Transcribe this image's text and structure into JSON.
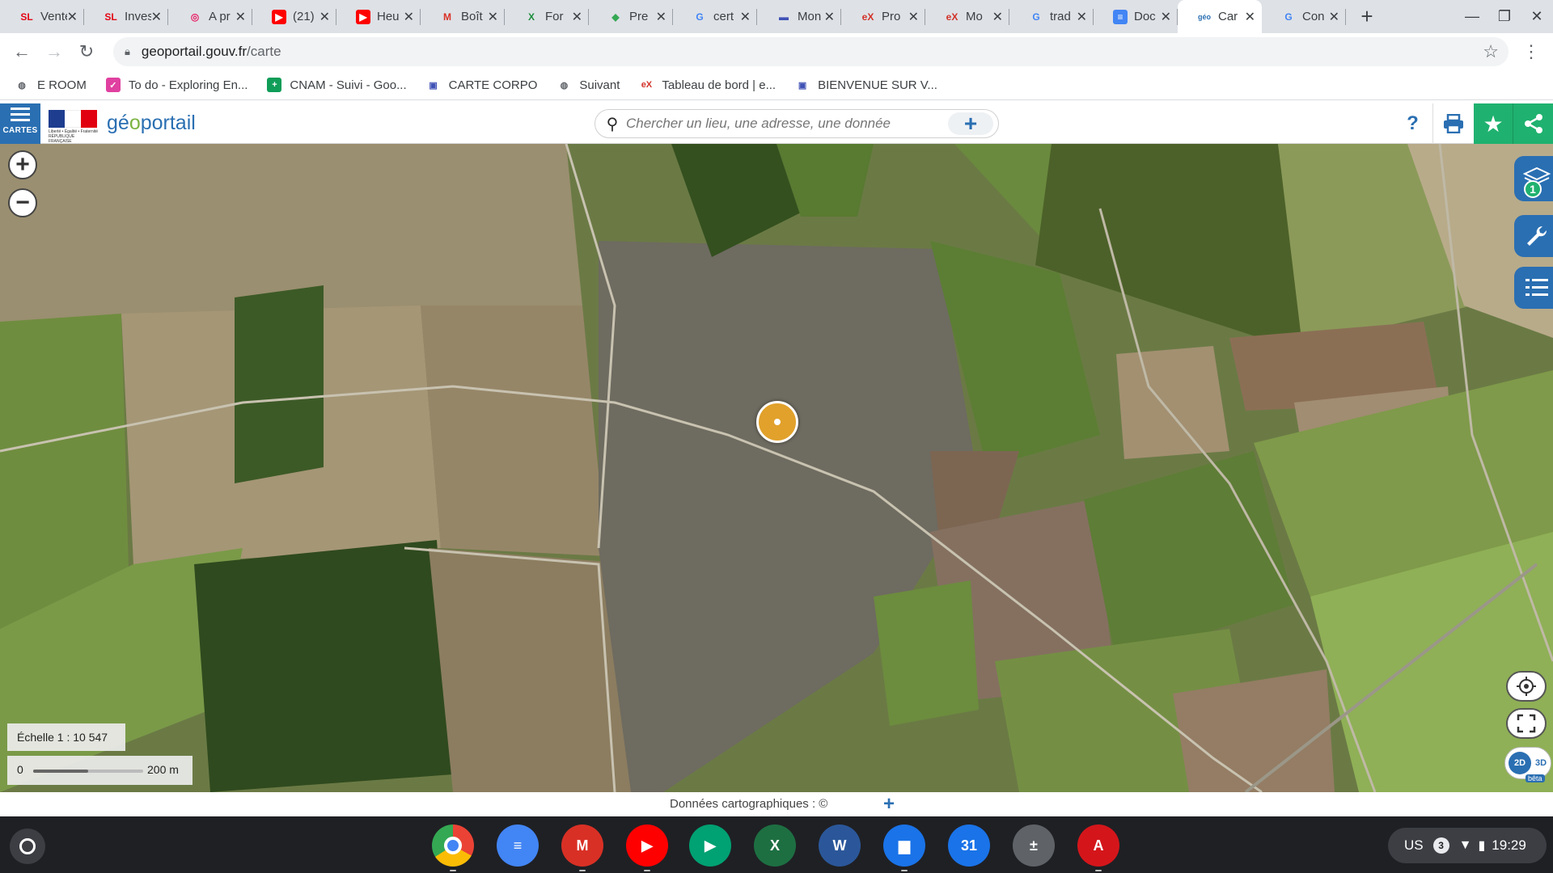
{
  "browser": {
    "tabs": [
      {
        "label": "Vente",
        "icon": "sl-icon",
        "fav_text": "SL",
        "fav_color": "#e30613",
        "fav_bg": "transparent"
      },
      {
        "label": "Inves",
        "icon": "sl-icon",
        "fav_text": "SL",
        "fav_color": "#e30613",
        "fav_bg": "transparent"
      },
      {
        "label": "A pr",
        "icon": "target-icon",
        "fav_text": "◎",
        "fav_color": "#e91e63",
        "fav_bg": "transparent"
      },
      {
        "label": "(21)",
        "icon": "youtube-icon",
        "fav_text": "▶",
        "fav_color": "#ffffff",
        "fav_bg": "#ff0000"
      },
      {
        "label": "Heu",
        "icon": "youtube-icon",
        "fav_text": "▶",
        "fav_color": "#ffffff",
        "fav_bg": "#ff0000"
      },
      {
        "label": "Boît",
        "icon": "gmail-icon",
        "fav_text": "M",
        "fav_color": "#d93025",
        "fav_bg": "transparent"
      },
      {
        "label": "For",
        "icon": "edx-x-icon",
        "fav_text": "X",
        "fav_color": "#1e8e3e",
        "fav_bg": "transparent"
      },
      {
        "label": "Pre",
        "icon": "maps-icon",
        "fav_text": "◆",
        "fav_color": "#34a853",
        "fav_bg": "transparent"
      },
      {
        "label": "cert",
        "icon": "google-icon",
        "fav_text": "G",
        "fav_color": "#4285f4",
        "fav_bg": "transparent"
      },
      {
        "label": "Mon",
        "icon": "site-icon",
        "fav_text": "▬",
        "fav_color": "#3f51b5",
        "fav_bg": "transparent"
      },
      {
        "label": "Pro",
        "icon": "edx-icon",
        "fav_text": "eX",
        "fav_color": "#d23228",
        "fav_bg": "transparent"
      },
      {
        "label": "Mo",
        "icon": "edx-icon",
        "fav_text": "eX",
        "fav_color": "#d23228",
        "fav_bg": "transparent"
      },
      {
        "label": "trad",
        "icon": "google-icon",
        "fav_text": "G",
        "fav_color": "#4285f4",
        "fav_bg": "transparent"
      },
      {
        "label": "Doc",
        "icon": "docs-icon",
        "fav_text": "≡",
        "fav_color": "#ffffff",
        "fav_bg": "#4285f4"
      },
      {
        "label": "Car",
        "icon": "geoportail-icon",
        "fav_text": "géo",
        "fav_color": "#2a6fb2",
        "fav_bg": "transparent",
        "active": true
      },
      {
        "label": "Con",
        "icon": "google-icon",
        "fav_text": "G",
        "fav_color": "#4285f4",
        "fav_bg": "transparent"
      }
    ],
    "new_tab_label": "+",
    "url_host": "geoportail.gouv.fr",
    "url_path": "/carte",
    "bookmarks": [
      {
        "label": "E ROOM",
        "icon": "globe-icon",
        "icon_text": "◍",
        "icon_color": "#5f6368",
        "icon_bg": "transparent"
      },
      {
        "label": "To do - Exploring En...",
        "icon": "todo-icon",
        "icon_text": "✓",
        "icon_color": "#ffffff",
        "icon_bg": "#e040a0"
      },
      {
        "label": "CNAM - Suivi - Goo...",
        "icon": "sheets-icon",
        "icon_text": "+",
        "icon_color": "#ffffff",
        "icon_bg": "#0f9d58"
      },
      {
        "label": "CARTE CORPO",
        "icon": "site-icon",
        "icon_text": "▣",
        "icon_color": "#3f51b5",
        "icon_bg": "transparent"
      },
      {
        "label": "Suivant",
        "icon": "globe-icon",
        "icon_text": "◍",
        "icon_color": "#5f6368",
        "icon_bg": "transparent"
      },
      {
        "label": "Tableau de bord | e...",
        "icon": "edx-icon",
        "icon_text": "eX",
        "icon_color": "#d23228",
        "icon_bg": "transparent"
      },
      {
        "label": "BIENVENUE SUR V...",
        "icon": "site-icon",
        "icon_text": "▣",
        "icon_color": "#3f51b5",
        "icon_bg": "transparent"
      }
    ]
  },
  "geoportail": {
    "cartes_label": "CARTES",
    "brand_prefix": "gé",
    "brand_accent": "o",
    "brand_suffix": "portail",
    "republic_text": "Liberté • Égalité • Fraternité RÉPUBLIQUE FRANÇAISE",
    "search_placeholder": "Chercher un lieu, une adresse, une donnée",
    "help_label": "?",
    "layers_count": "1",
    "scale_text": "Échelle 1 : 10 547",
    "scale_zero": "0",
    "scale_distance": "200 m",
    "btn_2d": "2D",
    "btn_3d": "3D",
    "beta_label": "bêta",
    "attribution": "Données cartographiques : ©",
    "attribution_more": "+",
    "zoom_in": "+",
    "zoom_out": "−"
  },
  "shelf": {
    "apps": [
      {
        "name": "chrome-app",
        "text": "",
        "bg": "conic-gradient(#ea4335 0 33%, #fbbc05 0 66%, #34a853 0)",
        "dot": true
      },
      {
        "name": "docs-app",
        "text": "≡",
        "bg": "#4285f4",
        "dot": false
      },
      {
        "name": "gmail-app",
        "text": "M",
        "bg": "#d93025",
        "dot": true
      },
      {
        "name": "youtube-app",
        "text": "▶",
        "bg": "#ff0000",
        "dot": true
      },
      {
        "name": "play-store-app",
        "text": "▶",
        "bg": "#00a173",
        "dot": false
      },
      {
        "name": "excel-app",
        "text": "X",
        "bg": "#1d6f42",
        "dot": false
      },
      {
        "name": "word-app",
        "text": "W",
        "bg": "#2b579a",
        "dot": false
      },
      {
        "name": "files-app",
        "text": "▆",
        "bg": "#1a73e8",
        "dot": true
      },
      {
        "name": "calendar-app",
        "text": "31",
        "bg": "#1a73e8",
        "dot": false
      },
      {
        "name": "calculator-app",
        "text": "±",
        "bg": "#5f6368",
        "dot": false
      },
      {
        "name": "acrobat-app",
        "text": "A",
        "bg": "#d4161b",
        "dot": true
      }
    ],
    "keyboard_layout": "US",
    "notification_count": "3",
    "time": "19:29"
  }
}
